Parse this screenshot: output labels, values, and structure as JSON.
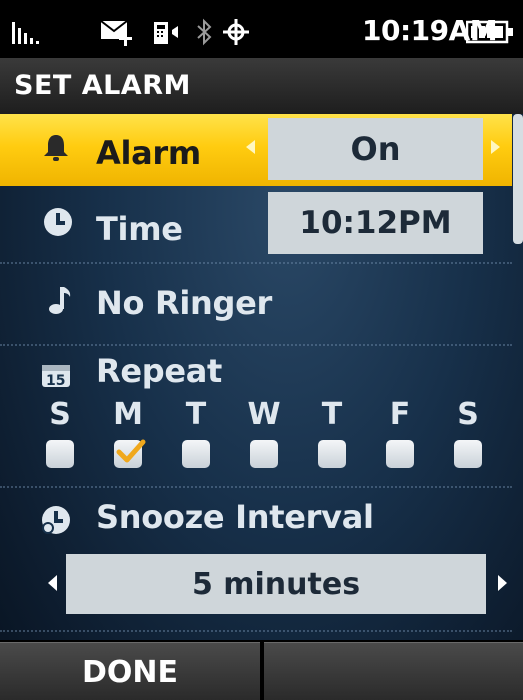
{
  "status_bar": {
    "time": "10:19AM",
    "icons": [
      "signal-icon",
      "message-icon",
      "vibrate-icon",
      "bluetooth-icon",
      "gps-icon",
      "battery-icon"
    ]
  },
  "screen_title": "SET ALARM",
  "alarm": {
    "icon": "bell-icon",
    "label": "Alarm",
    "value": "On"
  },
  "time": {
    "icon": "clock-icon",
    "label": "Time",
    "value": "10:12PM"
  },
  "ringer": {
    "icon": "music-note-icon",
    "label": "No Ringer"
  },
  "repeat": {
    "icon": "calendar-icon",
    "label": "Repeat",
    "days": [
      {
        "letter": "S",
        "checked": false
      },
      {
        "letter": "M",
        "checked": true
      },
      {
        "letter": "T",
        "checked": false
      },
      {
        "letter": "W",
        "checked": false
      },
      {
        "letter": "T",
        "checked": false
      },
      {
        "letter": "F",
        "checked": false
      },
      {
        "letter": "S",
        "checked": false
      }
    ]
  },
  "snooze": {
    "icon": "snooze-clock-icon",
    "label": "Snooze Interval",
    "value": "5 minutes"
  },
  "softkeys": {
    "left": "DONE",
    "right": ""
  },
  "colors": {
    "highlight": "#ffcc10",
    "check": "#f0a81c",
    "value_box": "#cfd6da"
  }
}
